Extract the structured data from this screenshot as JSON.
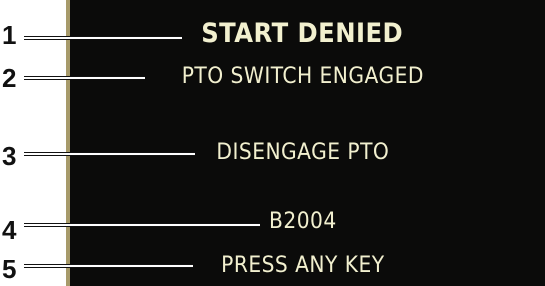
{
  "display": {
    "line1": "START DENIED",
    "line2": "PTO SWITCH ENGAGED",
    "line3": "DISENGAGE PTO",
    "line4": "B2004",
    "line5": "PRESS ANY KEY"
  },
  "callouts": [
    "1",
    "2",
    "3",
    "4",
    "5"
  ],
  "colors": {
    "screen_background": "#0b0b0a",
    "screen_text": "#f2f0cf",
    "callout_text": "#111111"
  }
}
